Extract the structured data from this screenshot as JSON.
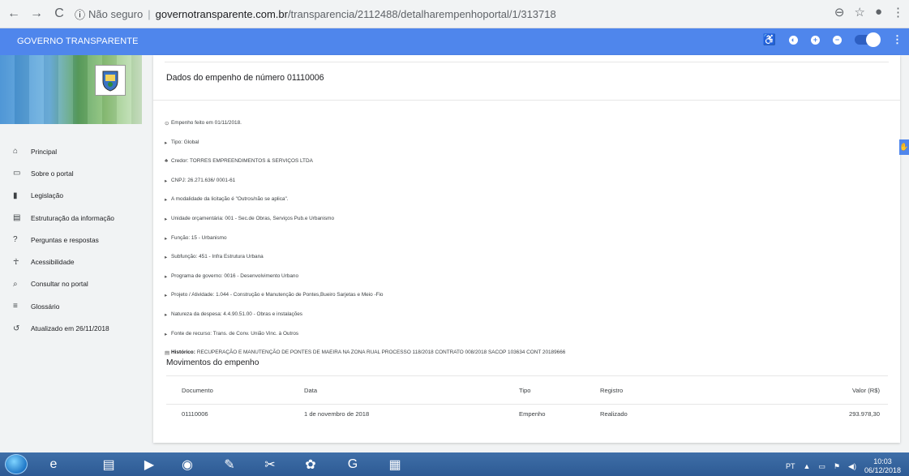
{
  "browser": {
    "nav_back": "←",
    "nav_forward": "→",
    "nav_reload": "C",
    "security_icon": "ⓘ",
    "security_text": "Não seguro",
    "url_host": "governotransparente.com.br",
    "url_path": "/transparencia/2112488/detalharempenhoportal/1/313718",
    "zoom_icon": "⊖",
    "star_icon": "☆",
    "profile_icon": "●",
    "menu_icon": "⋮"
  },
  "header": {
    "title": "GOVERNO TRANSPARENTE",
    "accessibility_icon": "♿",
    "contrast_icon": "◐",
    "increase_font_icon": "+",
    "decrease_font_icon": "−",
    "menu_icon": "⋮"
  },
  "sidebar": {
    "items": [
      {
        "icon": "⌂",
        "label": "Principal"
      },
      {
        "icon": "▭",
        "label": "Sobre o portal"
      },
      {
        "icon": "▮",
        "label": "Legislação"
      },
      {
        "icon": "▤",
        "label": "Estruturação da informação"
      },
      {
        "icon": "?",
        "label": "Perguntas e respostas"
      },
      {
        "icon": "☥",
        "label": "Acessibilidade"
      },
      {
        "icon": "⌕",
        "label": "Consultar no portal"
      },
      {
        "icon": "≡",
        "label": "Glossário"
      },
      {
        "icon": "↺",
        "label": "Atualizado em 26/11/2018"
      }
    ]
  },
  "main": {
    "title": "Dados do empenho de número 01110006",
    "details": [
      {
        "icon": "⊙",
        "text": "Empenho feito em 01/11/2018."
      },
      {
        "icon": "▸",
        "text": "Tipo: Global"
      },
      {
        "icon": "♣",
        "text": "Credor: TORRES EMPREENDIMENTOS & SERVIÇOS LTDA"
      },
      {
        "icon": "▸",
        "text": "CNPJ: 26.271.636/ 0001-61"
      },
      {
        "icon": "▸",
        "text": "A modalidade da licitação é \"Outros/não se aplica\"."
      },
      {
        "icon": "▸",
        "text": "Unidade orçamentária: 001 - Sec.de Obras, Serviços Pub.e Urbanismo"
      },
      {
        "icon": "▸",
        "text": "Função: 15 - Urbanismo"
      },
      {
        "icon": "▸",
        "text": "Subfunção: 451 - Infra Estrutura Urbana"
      },
      {
        "icon": "▸",
        "text": "Programa de governo: 0016 - Desenvolvimento Urbano"
      },
      {
        "icon": "▸",
        "text": "Projeto / Atividade: 1.044 - Construção e Manutenção de Pontes,Bueiro Sarjetas e Meio -Fio"
      },
      {
        "icon": "▸",
        "text": "Natureza da despesa: 4.4.90.51.00 - Obras e instalações"
      },
      {
        "icon": "▸",
        "text": "Fonte de recurso: Trans. de Conv. União Vinc. à Outros"
      }
    ],
    "historico_label": "Histórico:",
    "historico_text": "RECUPERAÇÃO E MANUTENÇÃO DE PONTES DE MAEIRA NA ZONA RUAL PROCESSO 118/2018 CONTRATO 008/2018 SACOP 103634 CONT 20189666",
    "movements_title": "Movimentos do empenho",
    "table": {
      "headers": [
        "Documento",
        "Data",
        "Tipo",
        "Registro",
        "Valor (R$)"
      ],
      "rows": [
        [
          "01110006",
          "1 de novembro de 2018",
          "Empenho",
          "Realizado",
          "293.978,30"
        ]
      ]
    }
  },
  "taskbar": {
    "apps": [
      {
        "icon": "e",
        "name": "internet-explorer"
      },
      {
        "icon": "▤",
        "name": "file-explorer"
      },
      {
        "icon": "▶",
        "name": "media-player"
      },
      {
        "icon": "◉",
        "name": "chrome"
      },
      {
        "icon": "✎",
        "name": "paint"
      },
      {
        "icon": "✂",
        "name": "snipping-tool"
      },
      {
        "icon": "✿",
        "name": "app-green"
      },
      {
        "icon": "G",
        "name": "app-pdf"
      },
      {
        "icon": "▦",
        "name": "calculator"
      }
    ],
    "language": "PT",
    "time": "10:03",
    "date": "06/12/2018"
  },
  "colors": {
    "header_blue": "#4f86ec",
    "card_bg": "#ffffff",
    "page_bg": "#f1f3f4"
  }
}
